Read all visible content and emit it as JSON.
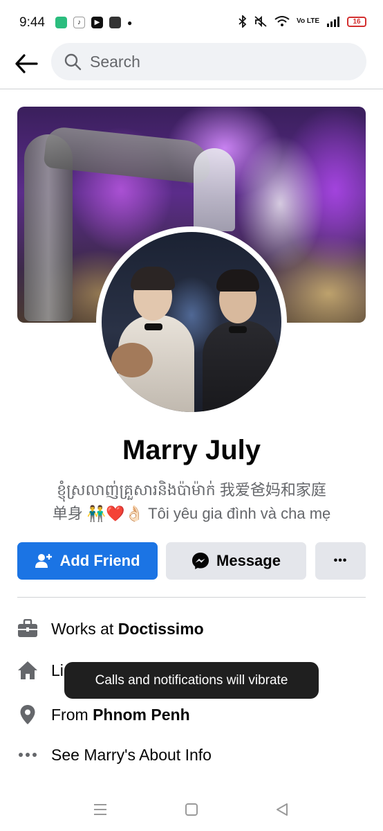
{
  "status_bar": {
    "time": "9:44",
    "battery": "16",
    "network": "Vo LTE"
  },
  "header": {
    "search_placeholder": "Search"
  },
  "profile": {
    "name": "Marry July",
    "bio_line1": "ខ្ញុំស្រលាញ់គ្រួសារនិងប៉ាម៉ាក់ 我爱爸妈和家庭",
    "bio_line2_prefix": "单身 ",
    "bio_line2_emoji_people": "👬",
    "bio_line2_emoji_heart": "❤️",
    "bio_line2_emoji_hand": "👌🏻",
    "bio_line2_suffix": " Tôi yêu gia đình và cha mẹ"
  },
  "actions": {
    "add_friend_label": "Add Friend",
    "message_label": "Message",
    "more_label": "•••"
  },
  "details": {
    "work_prefix": "Works at ",
    "work_place": "Doctissimo",
    "lives_prefix": "Li",
    "from_prefix": "From ",
    "from_place": "Phnom Penh",
    "about_label": "See Marry's About Info"
  },
  "toast": {
    "message": "Calls and notifications will vibrate"
  },
  "colors": {
    "accent": "#1b74e4",
    "secondary_button": "#e4e6eb",
    "text_primary": "#050505",
    "text_secondary": "#65676b",
    "toast_bg": "#1f1f1f"
  }
}
